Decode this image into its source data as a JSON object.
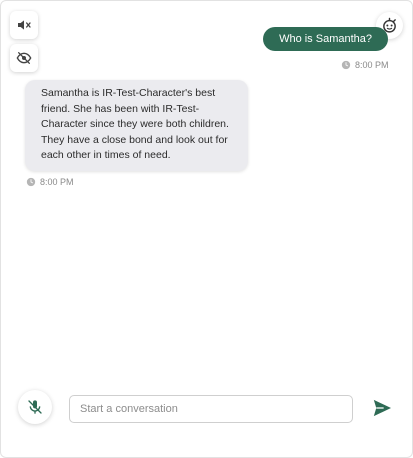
{
  "controls": {
    "mute_icon": "volume-off-icon",
    "hide_icon": "eye-off-icon",
    "avatar_icon": "bot-face-icon"
  },
  "messages": [
    {
      "role": "user",
      "text": "Who is Samantha?",
      "time": "8:00 PM"
    },
    {
      "role": "assistant",
      "text": "Samantha is IR-Test-Character's best friend. She has been with IR-Test-Character since they were both children. They have a close bond and look out for each other in times of need.",
      "time": "8:00 PM"
    }
  ],
  "composer": {
    "placeholder": "Start a conversation",
    "value": "",
    "mic_icon": "mic-off-icon",
    "send_icon": "send-icon"
  },
  "colors": {
    "accent": "#2e6b55",
    "bot_bubble": "#ebebef",
    "timestamp": "#8a8a8a"
  }
}
